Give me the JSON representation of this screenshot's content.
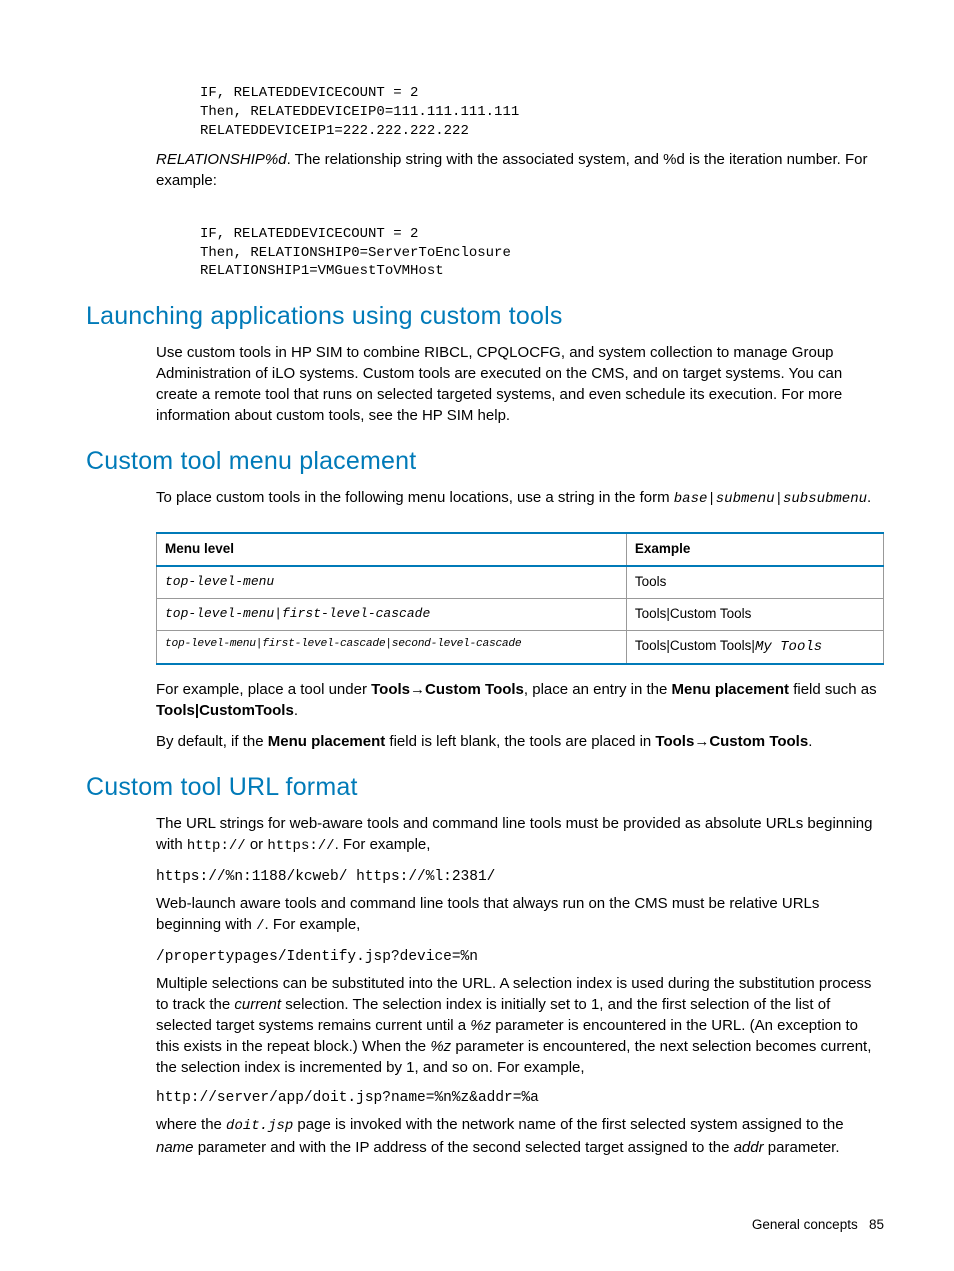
{
  "code1": "IF, RELATEDDEVICECOUNT = 2\nThen, RELATEDDEVICEIP0=111.111.111.111\nRELATEDDEVICEIP1=222.222.222.222",
  "p1_a": "RELATIONSHIP%d",
  "p1_b": ". The relationship string with the associated system, and %d is the iteration number. For example:",
  "code2": "IF, RELATEDDEVICECOUNT = 2\nThen, RELATIONSHIP0=ServerToEnclosure\nRELATIONSHIP1=VMGuestToVMHost",
  "h1": "Launching applications using custom tools",
  "p2": "Use custom tools in HP SIM to combine RIBCL, CPQLOCFG, and system collection to manage Group Administration of iLO systems. Custom tools are executed on the CMS, and on target systems. You can create a remote tool that runs on selected targeted systems, and even schedule its execution. For more information about custom tools, see the HP SIM help.",
  "h2": "Custom tool menu placement",
  "p3_a": "To place custom tools in the following menu locations, use a string in the form ",
  "p3_b": "base|submenu|subsubmenu",
  "p3_c": ".",
  "table": {
    "headers": [
      "Menu level",
      "Example"
    ],
    "rows": [
      {
        "c0_class": "mono-cell",
        "c0": "top-level-menu",
        "c1_class": "",
        "c1": "Tools"
      },
      {
        "c0_class": "mono-cell",
        "c0": "top-level-menu|first-level-cascade",
        "c1_class": "",
        "c1": "Tools|Custom Tools"
      },
      {
        "c0_class": "mono-cell-sm",
        "c0": "top-level-menu|first-level-cascade|second-level-cascade",
        "c1_class": "",
        "c1_parts": [
          "Tools|Custom Tools|",
          "My Tools"
        ]
      }
    ]
  },
  "p4_parts": [
    "For example, place a tool under ",
    "Tools",
    "→",
    "Custom Tools",
    ", place an entry in the ",
    "Menu placement",
    " field such as ",
    "Tools|CustomTools",
    "."
  ],
  "p5_parts": [
    "By default, if the ",
    "Menu placement",
    " field is left blank, the tools are placed in ",
    "Tools",
    "→",
    "Custom Tools",
    "."
  ],
  "h3": "Custom tool URL format",
  "p6_a": "The URL strings for web-aware tools and command line tools must be provided as absolute URLs beginning with ",
  "p6_b": "http://",
  "p6_c": " or ",
  "p6_d": "https://",
  "p6_e": ". For example,",
  "code3": "https://%n:1188/kcweb/ https://%l:2381/",
  "p7_a": "Web-launch aware tools and command line tools that always run on the CMS must be relative URLs beginning with ",
  "p7_b": "/",
  "p7_c": ". For example,",
  "code4": "/propertypages/Identify.jsp?device=%n",
  "p8_parts": [
    "Multiple selections can be substituted into the URL. A selection index is used during the substitution process to track the ",
    "current",
    " selection. The selection index is initially set to 1, and the first selection of the list of selected target systems remains current until a ",
    "%z",
    " parameter is encountered in the URL. (An exception to this exists in the repeat block.) When the ",
    "%z",
    " parameter is encountered, the next selection becomes current, the selection index is incremented by 1, and so on. For example,"
  ],
  "code5": "http://server/app/doit.jsp?name=%n%z&addr=%a",
  "p9_parts": [
    "where the ",
    "doit.jsp",
    " page is invoked with the network name of the first selected system assigned to the ",
    "name",
    " parameter and with the IP address of the second selected target assigned to the ",
    "addr",
    " parameter."
  ],
  "footer_a": "General concepts",
  "footer_b": "85"
}
